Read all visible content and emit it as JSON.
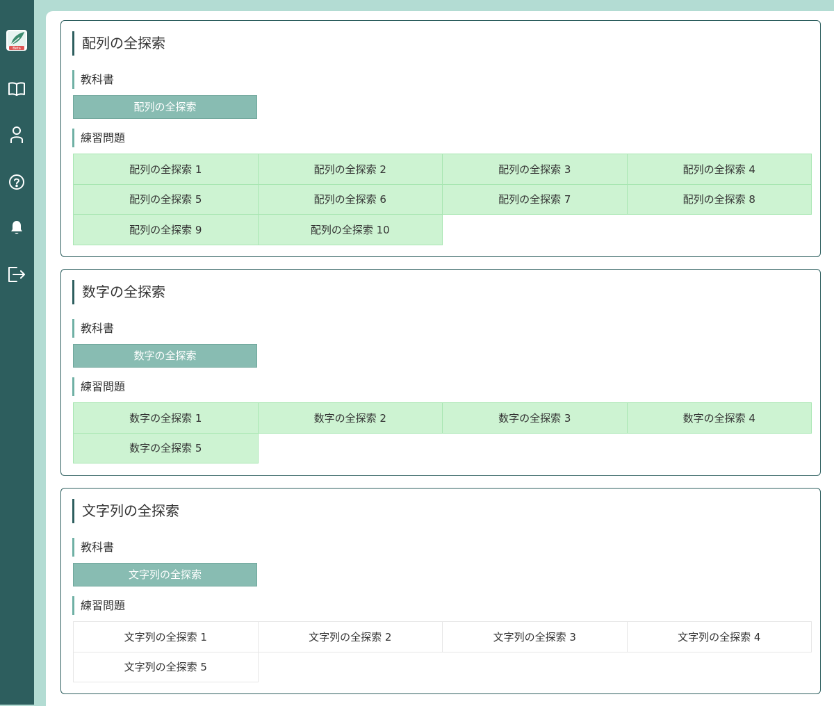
{
  "logo": {
    "badge": "Beta"
  },
  "sidebar": {
    "items": [
      {
        "icon": "book-icon"
      },
      {
        "icon": "user-icon"
      },
      {
        "icon": "help-icon"
      },
      {
        "icon": "bell-icon"
      },
      {
        "icon": "logout-icon"
      }
    ]
  },
  "sections": [
    {
      "title": "配列の全探索",
      "textbook_heading": "教科書",
      "textbook_label": "配列の全探索",
      "exercises_heading": "練習問題",
      "exercises": [
        "配列の全探索 1",
        "配列の全探索 2",
        "配列の全探索 3",
        "配列の全探索 4",
        "配列の全探索 5",
        "配列の全探索 6",
        "配列の全探索 7",
        "配列の全探索 8",
        "配列の全探索 9",
        "配列の全探索 10"
      ]
    },
    {
      "title": "数字の全探索",
      "textbook_heading": "教科書",
      "textbook_label": "数字の全探索",
      "exercises_heading": "練習問題",
      "exercises": [
        "数字の全探索 1",
        "数字の全探索 2",
        "数字の全探索 3",
        "数字の全探索 4",
        "数字の全探索 5"
      ]
    },
    {
      "title": "文字列の全探索",
      "textbook_heading": "教科書",
      "textbook_label": "文字列の全探索",
      "exercises_heading": "練習問題",
      "exercises": [
        "文字列の全探索 1",
        "文字列の全探索 2",
        "文字列の全探索 3",
        "文字列の全探索 4",
        "文字列の全探索 5"
      ]
    }
  ],
  "colors": {
    "sidebar": "#2d5e5e",
    "background": "#b3dcd3",
    "textbook_button": "#88bcb2",
    "exercise_completed": "#cdf3d2",
    "exercise_incomplete": "#ffffff"
  }
}
